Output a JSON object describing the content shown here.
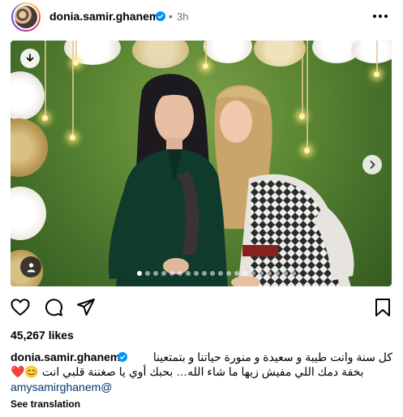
{
  "post": {
    "username": "donia.samir.ghanem",
    "time_ago": "3h",
    "separator": "•",
    "carousel": {
      "total_slides": 20,
      "active_index": 0
    },
    "likes": "45,267 likes",
    "caption": {
      "username": "donia.samir.ghanem",
      "line1": "كل سنة وانت طيبة و سعيدة و منورة حياتنا و بتمتعينا",
      "line2": "بخفة دمك اللي مفيش زيها ما شاء الله… بحبك أوي يا صغننة قلبي انت 😊❤️",
      "mention": "amysamirghanem@"
    },
    "see_translation": "See translation"
  },
  "icons": {
    "verified": "verified-badge-icon",
    "more": "more-horizontal-icon",
    "download": "download-icon",
    "next": "chevron-right-icon",
    "tag": "user-tag-icon",
    "like": "heart-icon",
    "comment": "comment-icon",
    "share": "paper-plane-icon",
    "save": "bookmark-icon"
  },
  "colors": {
    "verified_blue": "#0095f6",
    "secondary_text": "#737373",
    "link": "#00376b"
  }
}
